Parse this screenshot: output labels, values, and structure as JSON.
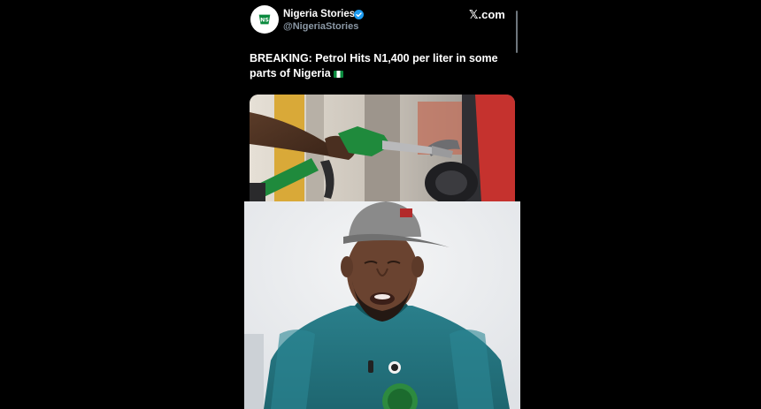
{
  "tweet": {
    "display_name": "Nigeria Stories",
    "handle": "@NigeriaStories",
    "source": "𝕏.com",
    "text_line1": "BREAKING: Petrol Hits N1,400 per liter in some",
    "text_line2": "parts of Nigeria",
    "avatar_text": "NS"
  },
  "colors": {
    "background": "#000000",
    "verified": "#1d9bf0",
    "brand_green": "#0b8a3e",
    "jersey": "#24737f"
  }
}
